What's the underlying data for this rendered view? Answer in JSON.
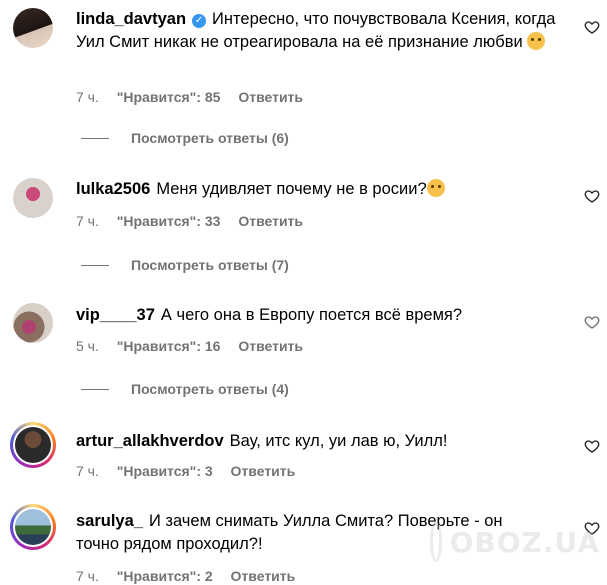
{
  "comments": [
    {
      "username": "linda_davtyan",
      "verified": true,
      "text": "Интересно, что почувствовала Ксения, когда Уил Смит никак не отреагировала на её признание любви",
      "emoji": "hugging-face",
      "time": "7 ч.",
      "likes": "\"Нравится\": 85",
      "reply": "Ответить",
      "view_replies": "Посмотреть ответы (6)"
    },
    {
      "username": "lulka2506",
      "verified": false,
      "text": "Меня удивляет почему не в росии?",
      "emoji": "thinking-face",
      "time": "7 ч.",
      "likes": "\"Нравится\": 33",
      "reply": "Ответить",
      "view_replies": "Посмотреть ответы (7)"
    },
    {
      "username": "vip____37",
      "verified": false,
      "text": "А чего она в Европу поется всё время?",
      "time": "5 ч.",
      "likes": "\"Нравится\": 16",
      "reply": "Ответить",
      "view_replies": "Посмотреть ответы (4)"
    },
    {
      "username": "artur_allakhverdov",
      "verified": false,
      "text": "Вау, итс кул, уи лав ю, Уилл!",
      "time": "7 ч.",
      "likes": "\"Нравится\": 3",
      "reply": "Ответить"
    },
    {
      "username": "sarulya_",
      "verified": false,
      "text": "И зачем снимать Уилла Смита? Поверьте - он точно рядом проходил?!",
      "time": "7 ч.",
      "likes": "\"Нравится\": 2",
      "reply": "Ответить"
    }
  ],
  "watermark": "OBOZ.UA",
  "colors": {
    "meta": "#737373",
    "verified": "#3797f0"
  }
}
